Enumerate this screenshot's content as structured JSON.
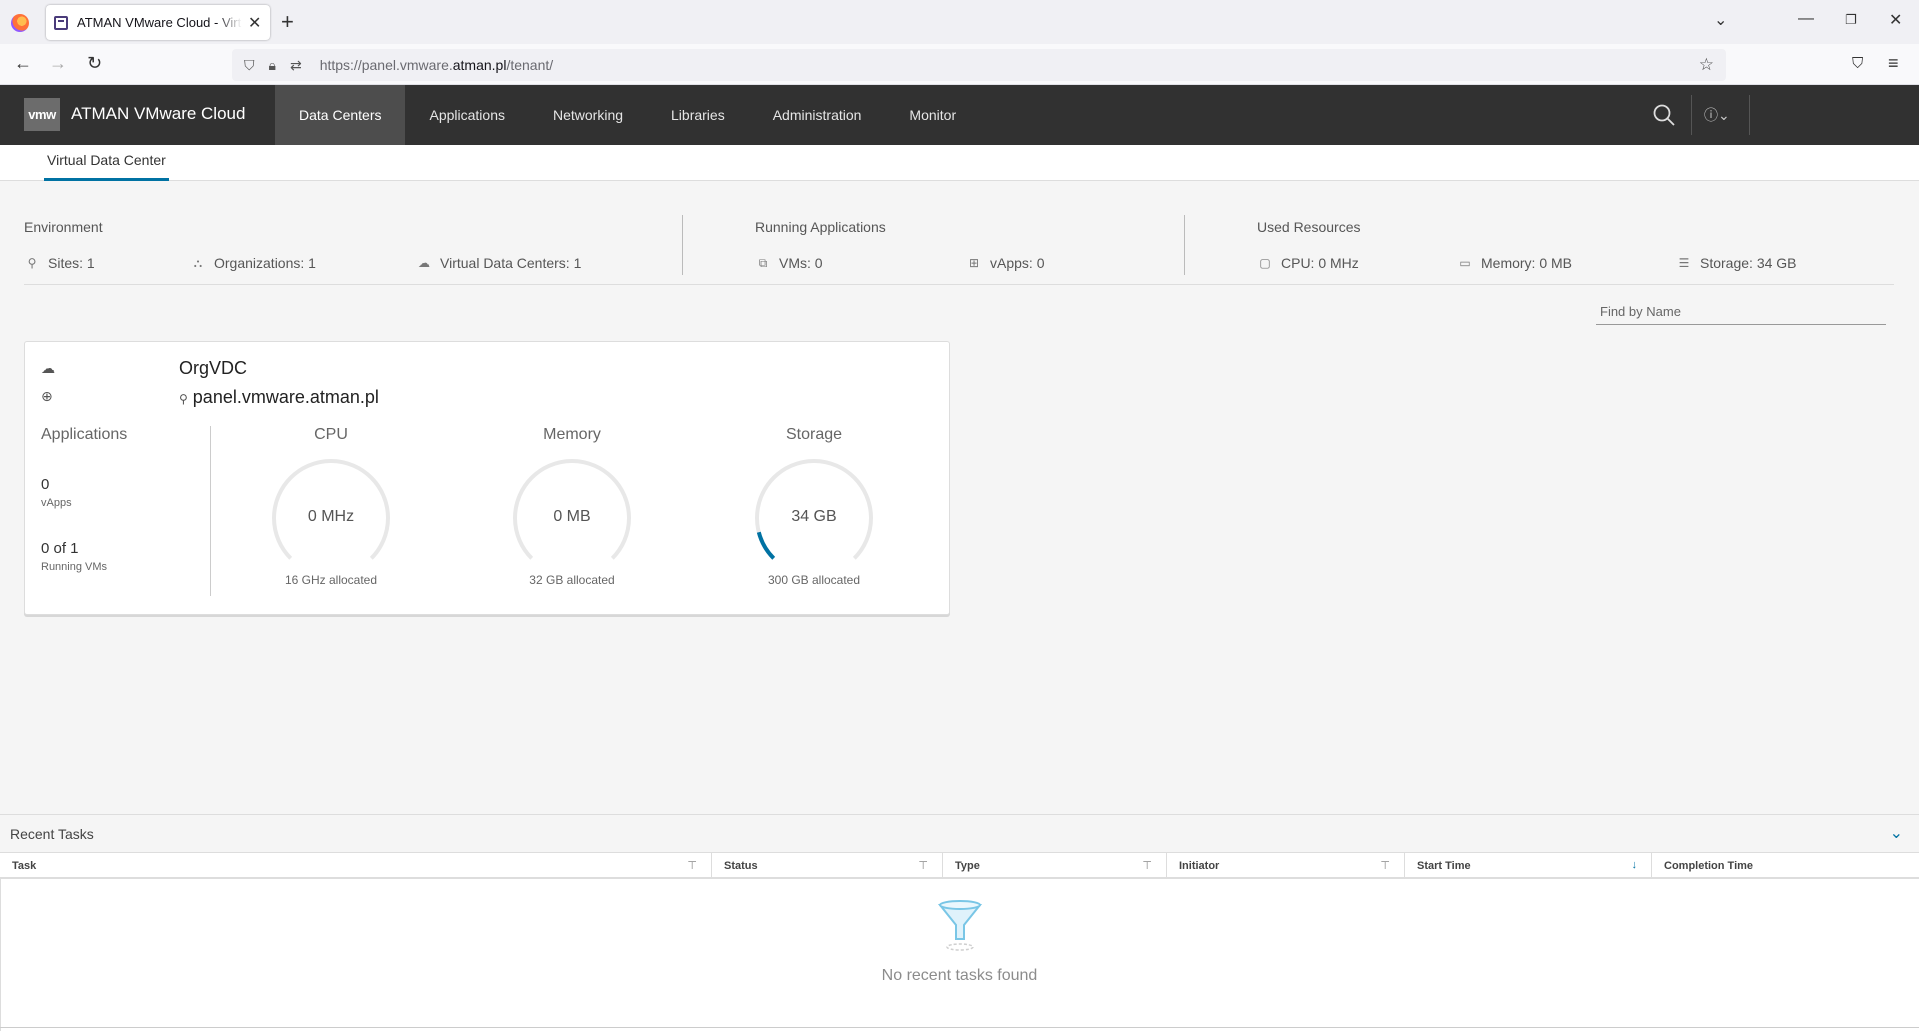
{
  "browser": {
    "tab_title": "ATMAN VMware Cloud - Virtual Data Center",
    "url_prefix": "https://panel.vmware.",
    "url_domain": "atman.pl",
    "url_path": "/tenant/"
  },
  "header": {
    "logo": "vmw",
    "title": "ATMAN VMware Cloud",
    "nav": [
      "Data Centers",
      "Applications",
      "Networking",
      "Libraries",
      "Administration",
      "Monitor"
    ],
    "active_nav": "Data Centers"
  },
  "subnav": {
    "tab": "Virtual Data Center"
  },
  "summary": {
    "environment": {
      "title": "Environment",
      "sites": "Sites:  1",
      "organizations": "Organizations:  1",
      "vdcs": "Virtual Data Centers:  1"
    },
    "running": {
      "title": "Running Applications",
      "vms": "VMs:  0",
      "vapps": "vApps:  0"
    },
    "resources": {
      "title": "Used Resources",
      "cpu": "CPU:  0 MHz",
      "memory": "Memory:  0 MB",
      "storage": "Storage:  34 GB"
    }
  },
  "search": {
    "placeholder": "Find by Name"
  },
  "card": {
    "name": "OrgVDC",
    "site": "panel.vmware.atman.pl",
    "applications": {
      "title": "Applications",
      "vapps_count": "0",
      "vapps_label": "vApps",
      "vms_count": "0 of 1",
      "vms_label": "Running VMs"
    },
    "gauges": [
      {
        "title": "CPU",
        "value": "0 MHz",
        "allocated": "16 GHz allocated",
        "fraction": 0
      },
      {
        "title": "Memory",
        "value": "0 MB",
        "allocated": "32 GB allocated",
        "fraction": 0
      },
      {
        "title": "Storage",
        "value": "34 GB",
        "allocated": "300 GB allocated",
        "fraction": 0.113
      }
    ]
  },
  "tasks": {
    "title": "Recent Tasks",
    "columns": [
      "Task",
      "Status",
      "Type",
      "Initiator",
      "Start Time",
      "Completion Time"
    ],
    "empty_message": "No recent tasks found"
  },
  "colors": {
    "accent": "#0072a3",
    "header_bg": "#313131",
    "gauge_track": "#e8e8e8"
  }
}
